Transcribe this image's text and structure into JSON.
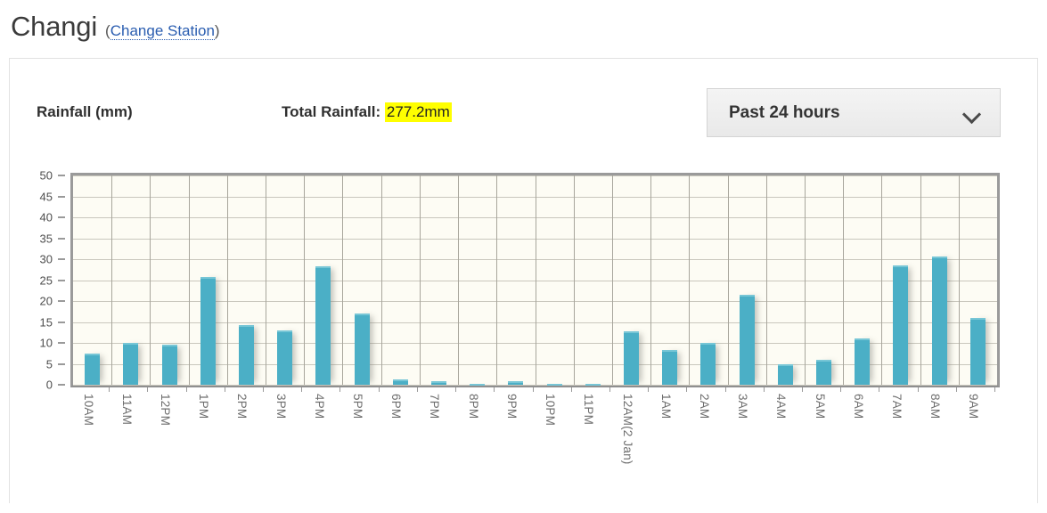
{
  "header": {
    "station_name": "Changi",
    "change_station_prefix": "(",
    "change_station_label": "Change Station",
    "change_station_suffix": ")"
  },
  "controls": {
    "rainfall_label": "Rainfall (mm)",
    "total_rainfall_label": "Total Rainfall:",
    "total_rainfall_value": "277.2mm",
    "period_selected": "Past 24 hours",
    "highlight_color": "#ffff00",
    "link_color": "#2a5db0"
  },
  "chart_data": {
    "type": "bar",
    "title": "Rainfall (mm)",
    "xlabel": "",
    "ylabel": "Rainfall (mm)",
    "ylim": [
      0,
      50
    ],
    "ytick_step": 5,
    "yticks": [
      0,
      5,
      10,
      15,
      20,
      25,
      30,
      35,
      40,
      45,
      50
    ],
    "grid": true,
    "legend": "none",
    "bar_color": "#4bafc6",
    "plot_background": "#fdfcf4",
    "categories": [
      "10AM",
      "11AM",
      "12PM",
      "1PM",
      "2PM",
      "3PM",
      "4PM",
      "5PM",
      "6PM",
      "7PM",
      "8PM",
      "9PM",
      "10PM",
      "11PM",
      "12AM(2 Jan)",
      "1AM",
      "2AM",
      "3AM",
      "4AM",
      "5AM",
      "6AM",
      "7AM",
      "8AM",
      "9AM"
    ],
    "values": [
      7.4,
      10.0,
      9.5,
      25.8,
      14.2,
      12.9,
      28.4,
      17.1,
      1.2,
      0.8,
      0.1,
      0.8,
      0.3,
      0.3,
      12.7,
      8.2,
      9.9,
      21.5,
      5.0,
      6.0,
      11.0,
      28.6,
      30.6,
      16.0
    ]
  }
}
